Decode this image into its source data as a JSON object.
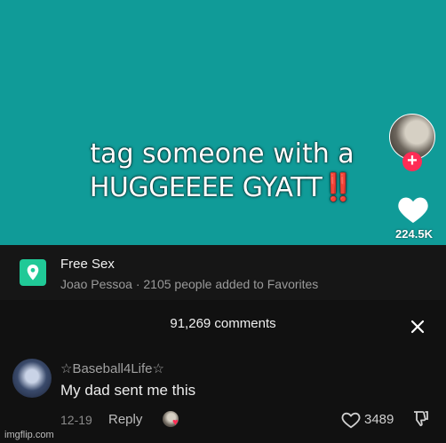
{
  "video": {
    "caption_line1": "tag someone with a",
    "caption_line2": "HUGGEEEE GYATT",
    "caption_emphasis": "‼️",
    "like_count": "224.5K",
    "background_color": "#109b98"
  },
  "location": {
    "title": "Free Sex",
    "subtitle": "Joao Pessoa · 2105 people added to Favorites",
    "icon": "map-pin-icon"
  },
  "comments": {
    "header": "91,269 comments",
    "items": [
      {
        "username": "☆Baseball4Life☆",
        "text": "My dad sent me this",
        "date": "12-19",
        "reply_label": "Reply",
        "like_count": "3489"
      }
    ]
  },
  "watermark": "imgflip.com",
  "colors": {
    "accent": "#fe2c55",
    "location_pin": "#20c997"
  }
}
